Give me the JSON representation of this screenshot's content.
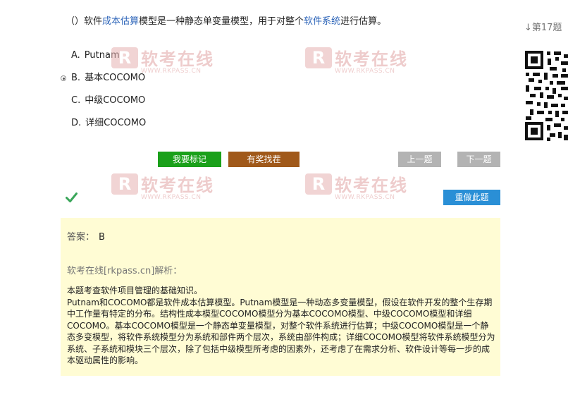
{
  "question": {
    "prefix": "（）软件",
    "kw1": "成本估算",
    "mid": "模型是一种静态单变量模型，用于对整个",
    "kw2": "软件系统",
    "suffix": "进行估算。"
  },
  "options": [
    {
      "letter": "A.",
      "text": "Putnam",
      "selected": false
    },
    {
      "letter": "B.",
      "text": "基本COCOMO",
      "selected": true
    },
    {
      "letter": "C.",
      "text": "中级COCOMO",
      "selected": false
    },
    {
      "letter": "D.",
      "text": "详细COCOMO",
      "selected": false
    }
  ],
  "buttons": {
    "mark": "我要标记",
    "report": "有奖找茬",
    "prev": "上一题",
    "next": "下一题",
    "redo": "重做此题"
  },
  "answer": {
    "label": "答案：",
    "value": "B"
  },
  "analysis": {
    "title": "软考在线[rkpass.cn]解析：",
    "lines": [
      "本题考查软件项目管理的基础知识。",
      "Putnam和COCOMO都是软件成本估算模型。Putnam模型是一种动态多变量模型，假设在软件开发的整个生存期中工作量有特定的分布。结构性成本模型COCOMO模型分为基本COCOMO模型、中级COCOMO模型和详细COCOMO。基本COCOMO模型是一个静态单变量模型，对整个软件系统进行估算；中级COCOMO模型是一个静态多变模型，将软件系统模型分为系统和部件两个层次，系统由部件构成；详细COCOMO模型将软件系统模型分为系统、子系统和模块三个层次，除了包括中级模型所考虑的因素外，还考虑了在需求分析、软件设计等每一步的成本驱动属性的影响。"
    ]
  },
  "sidebar": {
    "question_number": "↓第17题",
    "qr_label": "qr-code"
  },
  "watermark": {
    "logo_letter": "R",
    "brand": "软考在线",
    "url": "WWW.RKPASS.CN"
  },
  "colors": {
    "mark_green": "#1aa01a",
    "report_brown": "#a0591a",
    "nav_gray": "#b3b3b3",
    "redo_blue": "#2a8fd6",
    "answer_bg": "#fffcd4",
    "keyword_blue": "#2b63b8",
    "check_green": "#3aa65a"
  }
}
